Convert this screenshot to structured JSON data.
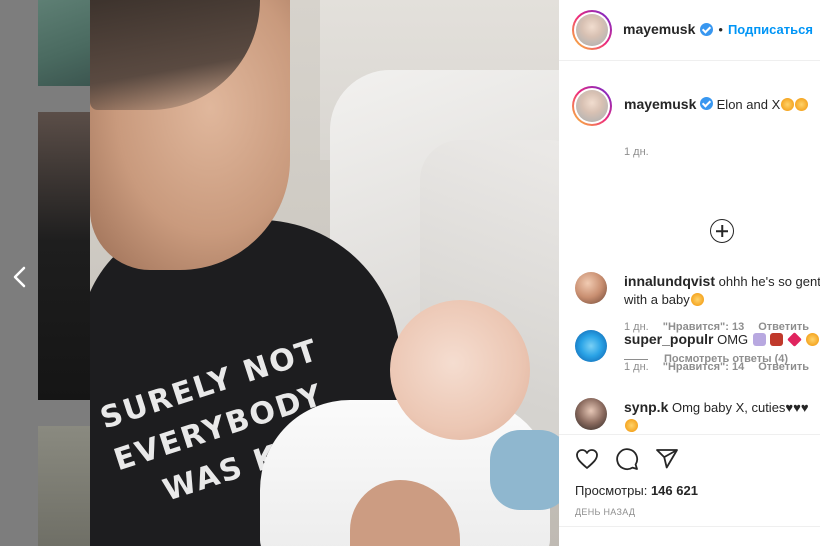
{
  "header": {
    "username": "mayemusk",
    "separator": "•",
    "follow_label": "Подписаться"
  },
  "caption": {
    "username": "mayemusk",
    "text": "Elon and X",
    "time": "1 дн."
  },
  "comments": [
    {
      "username": "innalundqvist",
      "text_line1": "ohhh he's so gent",
      "text_line2": "with a baby",
      "time": "1 дн.",
      "likes": "\"Нравится\": 13",
      "reply": "Ответить"
    },
    {
      "username": "super_populr",
      "text_line1": "OMG",
      "time": "1 дн.",
      "likes": "\"Нравится\": 14",
      "reply": "Ответить"
    },
    {
      "username": "synp.k",
      "text_line1": "Omg baby X, cuties♥♥♥"
    }
  ],
  "view_replies": "Посмотреть ответы (4)",
  "footer": {
    "views_label": "Просмотры:",
    "views_count": "146 621",
    "date": "ДЕНЬ НАЗАД"
  },
  "media": {
    "shirt_text": "SURELY NOT\nEVERYBODY\n   WAS KUNG FU"
  },
  "colors": {
    "link": "#0095f6",
    "verified": "#3897f0",
    "text": "#262626",
    "muted": "#8e8e8e"
  },
  "icons": [
    "chevron-left-icon",
    "verified-badge-icon",
    "plus-circle-icon",
    "heart-icon",
    "comment-icon",
    "share-icon"
  ]
}
